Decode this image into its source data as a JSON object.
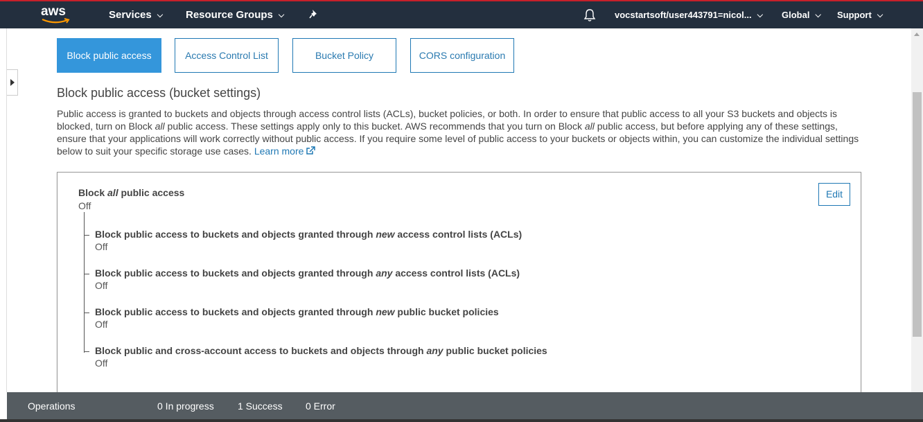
{
  "nav": {
    "logo_text": "aws",
    "services_label": "Services",
    "resource_groups_label": "Resource Groups",
    "account_label": "vocstartsoft/user443791=nicol...",
    "region_label": "Global",
    "support_label": "Support",
    "colors": {
      "bg": "#232f3e",
      "accent": "#ff9900",
      "top_border": "#c7202a"
    }
  },
  "tabs": [
    {
      "label": "Block public access",
      "active": true
    },
    {
      "label": "Access Control List",
      "active": false
    },
    {
      "label": "Bucket Policy",
      "active": false
    },
    {
      "label": "CORS configuration",
      "active": false
    }
  ],
  "section": {
    "heading": "Block public access (bucket settings)",
    "desc_part1": "Public access is granted to buckets and objects through access control lists (ACLs), bucket policies, or both. In order to ensure that public access to all your S3 buckets and objects is blocked, turn on Block ",
    "desc_all_1": "all",
    "desc_part2": " public access. These settings apply only to this bucket. AWS recommends that you turn on Block ",
    "desc_all_2": "all",
    "desc_part3": " public access, but before applying any of these settings, ensure that your applications will work correctly without public access. If you require some level of public access to your buckets or objects within, you can customize the individual settings below to suit your specific storage use cases. ",
    "learn_more": "Learn more"
  },
  "panel": {
    "master_title_pre": "Block ",
    "master_title_em": "all",
    "master_title_post": " public access",
    "master_value": "Off",
    "edit_label": "Edit",
    "settings": [
      {
        "pre": "Block public access to buckets and objects granted through ",
        "em": "new",
        "post": " access control lists (ACLs)",
        "value": "Off"
      },
      {
        "pre": "Block public access to buckets and objects granted through ",
        "em": "any",
        "post": " access control lists (ACLs)",
        "value": "Off"
      },
      {
        "pre": "Block public access to buckets and objects granted through ",
        "em": "new",
        "post": " public bucket policies",
        "value": "Off"
      },
      {
        "pre": "Block public and cross-account access to buckets and objects through ",
        "em": "any",
        "post": " public bucket policies",
        "value": "Off"
      }
    ]
  },
  "operations": {
    "label": "Operations",
    "in_progress": "0 In progress",
    "success": "1 Success",
    "error": "0 Error"
  },
  "icons": [
    "aws-logo",
    "chevron-down-icon",
    "pin-icon",
    "bell-icon",
    "external-link-icon",
    "caret-right-icon"
  ]
}
